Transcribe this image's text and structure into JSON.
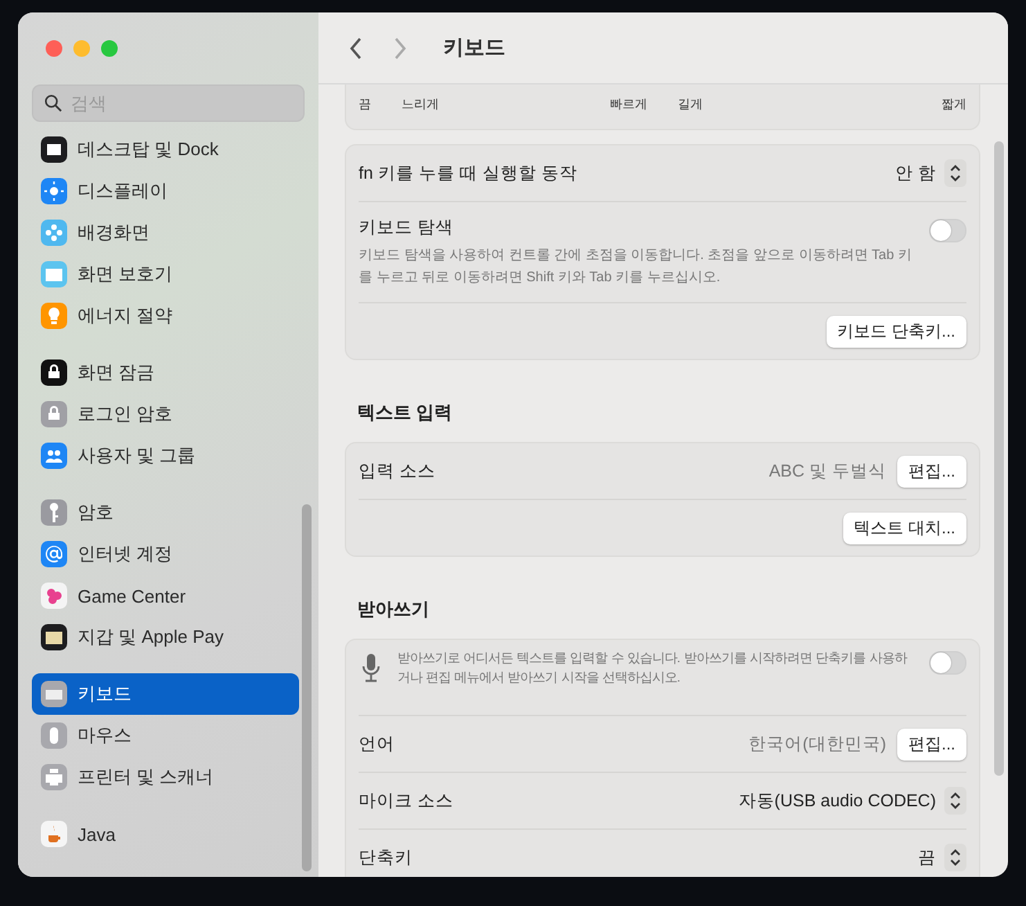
{
  "window": {
    "title": "키보드"
  },
  "sidebar": {
    "search": {
      "placeholder": "검색"
    },
    "groups": [
      {
        "items": [
          {
            "label": "데스크탑 및 Dock",
            "kind": "dock",
            "selected": false
          },
          {
            "label": "디스플레이",
            "kind": "display",
            "selected": false
          },
          {
            "label": "배경화면",
            "kind": "wallpaper",
            "selected": false
          },
          {
            "label": "화면 보호기",
            "kind": "screensaver",
            "selected": false
          },
          {
            "label": "에너지 절약",
            "kind": "energy",
            "selected": false
          }
        ]
      },
      {
        "items": [
          {
            "label": "화면 잠금",
            "kind": "lockscreen",
            "selected": false
          },
          {
            "label": "로그인 암호",
            "kind": "login",
            "selected": false
          },
          {
            "label": "사용자 및 그룹",
            "kind": "users",
            "selected": false
          }
        ]
      },
      {
        "items": [
          {
            "label": "암호",
            "kind": "passwords",
            "selected": false
          },
          {
            "label": "인터넷 계정",
            "kind": "internet",
            "selected": false
          },
          {
            "label": "Game Center",
            "kind": "gamecenter",
            "selected": false
          },
          {
            "label": "지갑 및 Apple Pay",
            "kind": "wallet",
            "selected": false
          }
        ]
      },
      {
        "items": [
          {
            "label": "키보드",
            "kind": "keyboard",
            "selected": true
          },
          {
            "label": "마우스",
            "kind": "mouse",
            "selected": false
          },
          {
            "label": "프린터 및 스캐너",
            "kind": "printer",
            "selected": false
          }
        ]
      },
      {
        "items": [
          {
            "label": "Java",
            "kind": "java",
            "selected": false
          }
        ]
      }
    ]
  },
  "sections": [
    {
      "rows": [
        {
          "kind": "labels",
          "left": [
            "끔",
            "느리게",
            "빠르게"
          ],
          "right": [
            "길게",
            "짧게"
          ]
        }
      ]
    },
    {
      "rows": [
        {
          "kind": "popup",
          "label": "fn 키를 누를 때 실행할 동작",
          "value": "안 함"
        },
        {
          "kind": "toggle",
          "label": "키보드 탐색",
          "description": "키보드 탐색을 사용하여 컨트롤 간에 초점을 이동합니다. 초점을 앞으로 이동하려면 Tab 키를 누르고 뒤로 이동하려면 Shift 키와 Tab 키를 누르십시오.",
          "on": false
        },
        {
          "kind": "button",
          "button": "키보드 단축키..."
        }
      ]
    },
    {
      "heading": "텍스트 입력",
      "rows": [
        {
          "kind": "value-button",
          "label": "입력 소스",
          "value": "ABC 및 두벌식",
          "button": "편집..."
        },
        {
          "kind": "button",
          "button": "텍스트 대치..."
        }
      ]
    },
    {
      "heading": "받아쓰기",
      "rows": [
        {
          "kind": "dictation",
          "description": "받아쓰기로 어디서든 텍스트를 입력할 수 있습니다. 받아쓰기를 시작하려면 단축키를 사용하거나 편집 메뉴에서 받아쓰기 시작을 선택하십시오.",
          "on": false
        },
        {
          "kind": "value-button",
          "label": "언어",
          "value": "한국어(대한민국)",
          "button": "편집..."
        },
        {
          "kind": "popup",
          "label": "마이크 소스",
          "value": "자동(USB audio CODEC)"
        },
        {
          "kind": "popup",
          "label": "단축키",
          "value": "끔"
        }
      ]
    }
  ]
}
